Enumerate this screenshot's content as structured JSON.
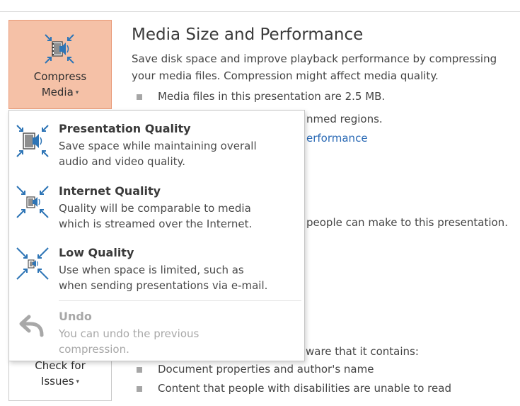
{
  "compress_media": {
    "label_line1": "Compress",
    "label_line2": "Media",
    "caret": "▾"
  },
  "section": {
    "title": "Media Size and Performance",
    "description_line1": "Save disk space and improve playback performance by compressing",
    "description_line2": "your media files. Compression might affect media quality.",
    "bullets": [
      "Media files in this presentation are 2.5 MB.",
      "nmed regions."
    ],
    "link": "erformance"
  },
  "background_fragments": {
    "line_people": "people can make to this presentation.",
    "line_ware": "ware that it contains:",
    "bullet_doc_props": "Document properties and author's name",
    "bullet_disabilities": "Content that people with disabilities are unable to read"
  },
  "check_issues": {
    "label_line1": "Check for",
    "label_line2": "Issues",
    "caret": "▾"
  },
  "menu": {
    "items": [
      {
        "title": "Presentation Quality",
        "desc1": "Save space while maintaining overall",
        "desc2": "audio and video quality."
      },
      {
        "title": "Internet Quality",
        "desc1": "Quality will be comparable to media",
        "desc2": "which is streamed over the Internet."
      },
      {
        "title": "Low Quality",
        "desc1": "Use when space is limited, such as",
        "desc2": "when sending presentations via e-mail."
      },
      {
        "title": "Undo",
        "desc1": "You can undo the previous",
        "desc2": "compression."
      }
    ]
  },
  "colors": {
    "accent_button": "#f5c1a7",
    "icon_blue": "#2e75b6",
    "link": "#2b6ab5"
  },
  "icons": [
    "compress-media-icon",
    "presentation-quality-icon",
    "internet-quality-icon",
    "low-quality-icon",
    "undo-icon"
  ]
}
